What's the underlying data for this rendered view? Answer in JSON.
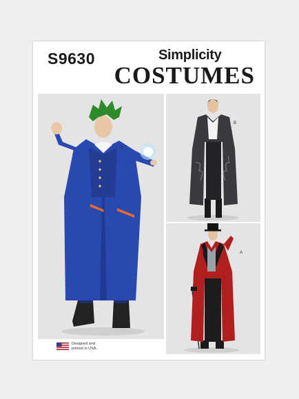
{
  "pattern": {
    "number": "S9630",
    "brand": "Simplicity",
    "line": "COSTUMES"
  },
  "views": {
    "c": "C",
    "b": "B",
    "a": "A"
  },
  "origin": {
    "text_line1": "Designed and",
    "text_line2": "printed in USA."
  },
  "colors": {
    "background": "#efefef",
    "card": "#ffffff",
    "view_c_coat": "#2a49b0",
    "view_b_coat": "#3a3a3e",
    "view_a_coat": "#b01e1e",
    "hair": "#2f8a2a"
  }
}
